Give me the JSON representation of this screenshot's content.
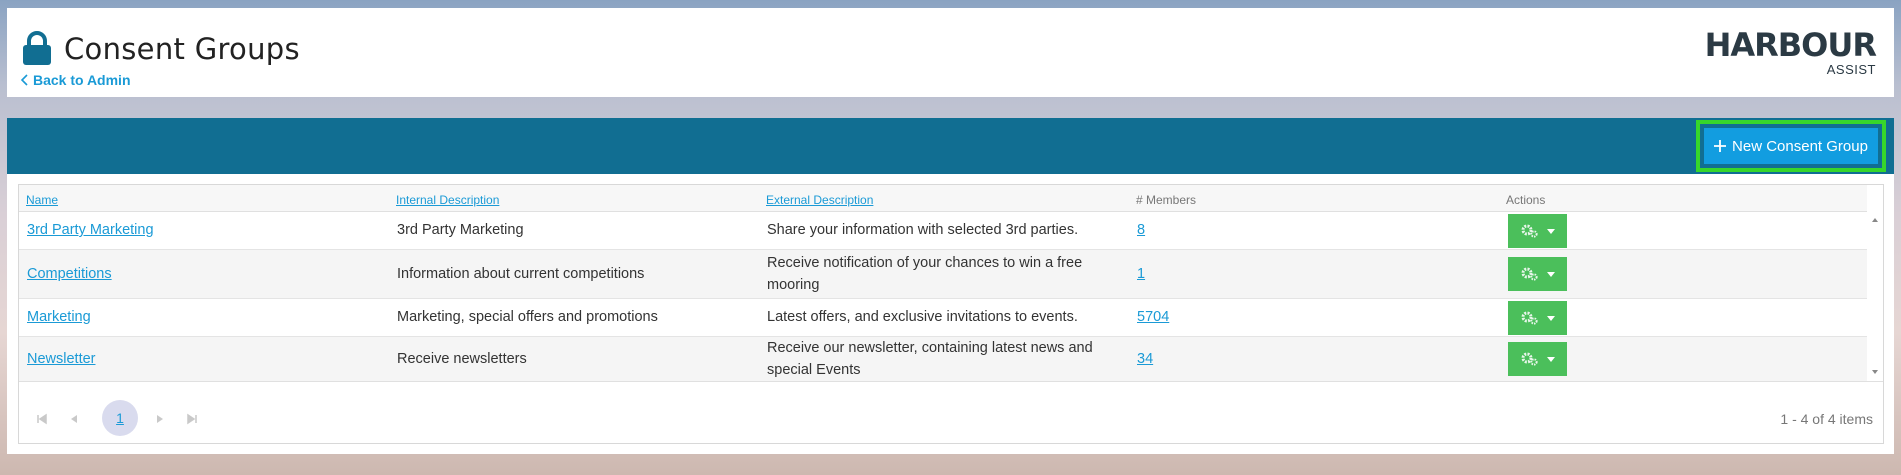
{
  "header": {
    "title": "Consent Groups",
    "back_link": "Back to Admin",
    "logo_main": "HARBOUR",
    "logo_sub": "ASSIST"
  },
  "toolbar": {
    "new_button": "New Consent Group"
  },
  "grid": {
    "columns": [
      "Name",
      "Internal Description",
      "External Description",
      "# Members",
      "Actions"
    ],
    "rows": [
      {
        "name": "3rd Party Marketing",
        "internal": "3rd Party Marketing",
        "external_1": "Share your information with selected 3rd parties.",
        "external_2": "",
        "members": "8"
      },
      {
        "name": "Competitions",
        "internal": "Information about current competitions",
        "external_1": "Receive notification of your chances to win a free",
        "external_2": "mooring",
        "members": "1"
      },
      {
        "name": "Marketing",
        "internal": "Marketing, special offers and promotions",
        "external_1": "Latest offers, and exclusive invitations to events.",
        "external_2": "",
        "members": "5704"
      },
      {
        "name": "Newsletter",
        "internal": "Receive newsletters",
        "external_1": "Receive our newsletter, containing latest news and",
        "external_2": "special Events",
        "members": "34"
      }
    ]
  },
  "pager": {
    "current_page": "1",
    "info": "1 - 4 of 4 items"
  },
  "colors": {
    "toolbar_bg": "#116e92",
    "primary_button": "#129de0",
    "highlight_border": "#37d62b",
    "action_button": "#4bbf5b",
    "link": "#1a9ad6"
  },
  "icons": [
    "lock-icon",
    "chevron-left-icon",
    "plus-icon",
    "gears-icon",
    "caret-down-icon",
    "first-page-icon",
    "prev-page-icon",
    "next-page-icon",
    "last-page-icon"
  ]
}
